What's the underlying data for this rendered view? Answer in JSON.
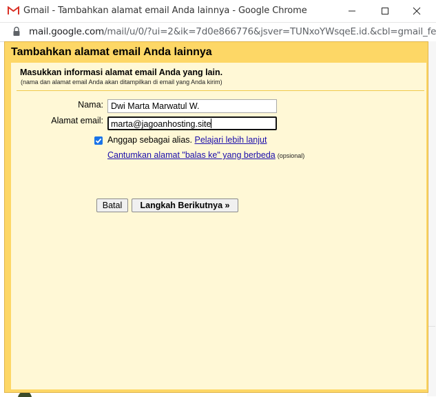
{
  "window": {
    "title": "Gmail - Tambahkan alamat email Anda lainnya - Google Chrome",
    "url_main": "mail.google.com",
    "url_rest": "/mail/u/0/?ui=2&ik=7d0e866776&jsver=TUNxoYWsqeE.id.&cbl=gmail_fe..."
  },
  "dialog": {
    "title": "Tambahkan alamat email Anda lainnya",
    "instruction": "Masukkan informasi alamat email Anda yang lain.",
    "instruction_note": "(nama dan alamat email Anda akan ditampilkan di email yang Anda kirim)",
    "name_label": "Nama:",
    "name_value": "Dwi Marta Marwatul W.",
    "email_label": "Alamat email:",
    "email_value": "marta@jagoanhosting.site",
    "alias_checked": true,
    "alias_label": "Anggap sebagai alias.",
    "learn_more": "Pelajari lebih lanjut",
    "reply_to_link": "Cantumkan alamat \"balas ke\" yang berbeda",
    "optional": "(opsional)",
    "cancel_button": "Batal",
    "next_button": "Langkah Berikutnya »"
  },
  "colors": {
    "dialog_header": "#fdd766",
    "dialog_body": "#fff8d6",
    "link": "#1a0dab",
    "checkbox": "#1a73e8"
  }
}
